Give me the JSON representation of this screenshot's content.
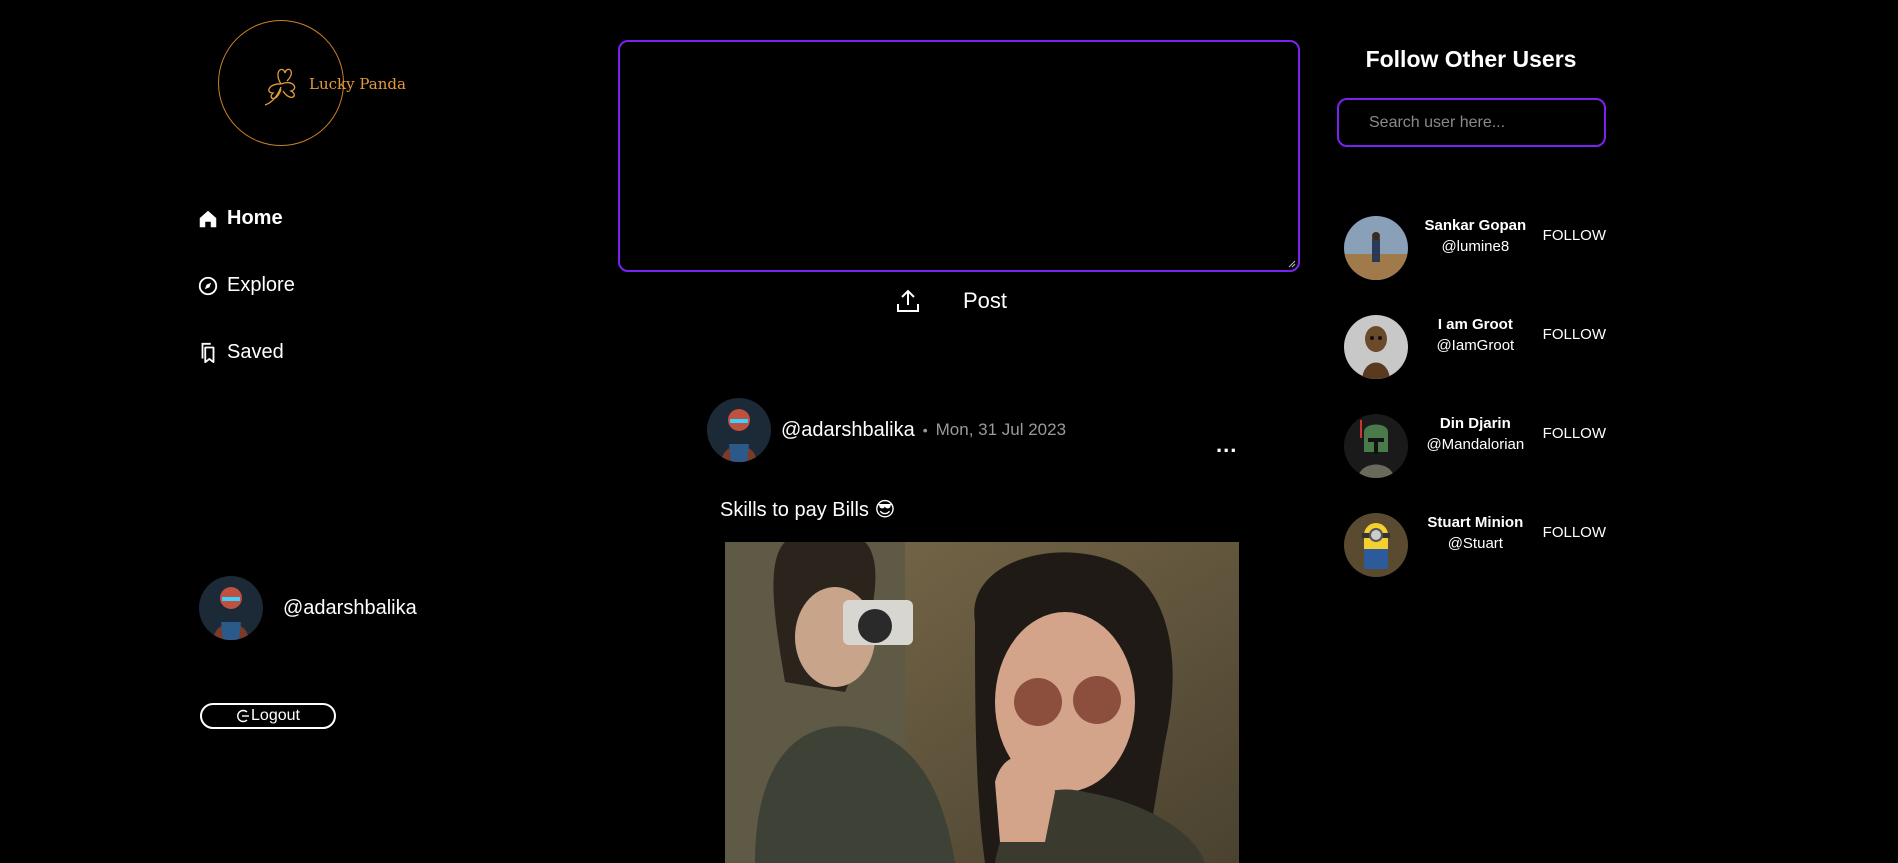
{
  "brand": {
    "name": "Lucky Panda",
    "accent": "#e39a3e",
    "highlight": "#7b22f0"
  },
  "nav": {
    "items": [
      {
        "label": "Home",
        "icon": "home-icon",
        "active": true
      },
      {
        "label": "Explore",
        "icon": "compass-icon",
        "active": false
      },
      {
        "label": "Saved",
        "icon": "bookmark-icon",
        "active": false
      }
    ]
  },
  "current_user": {
    "handle": "@adarshbalika"
  },
  "logout": {
    "label": "Logout",
    "icon": "logout-icon"
  },
  "composer": {
    "value": "",
    "post_label": "Post",
    "upload_icon": "upload-icon"
  },
  "post": {
    "user": "@adarshbalika",
    "separator": "•",
    "date": "Mon, 31 Jul 2023",
    "text": "Skills to pay Bills 😎",
    "more_label": "..."
  },
  "follow_panel": {
    "title": "Follow Other Users",
    "search_placeholder": "Search user here...",
    "follow_label": "FOLLOW",
    "users": [
      {
        "name": "Sankar Gopan",
        "handle": "@lumine8"
      },
      {
        "name": "I am Groot",
        "handle": "@IamGroot"
      },
      {
        "name": "Din Djarin",
        "handle": "@Mandalorian"
      },
      {
        "name": "Stuart Minion",
        "handle": "@Stuart"
      }
    ]
  }
}
